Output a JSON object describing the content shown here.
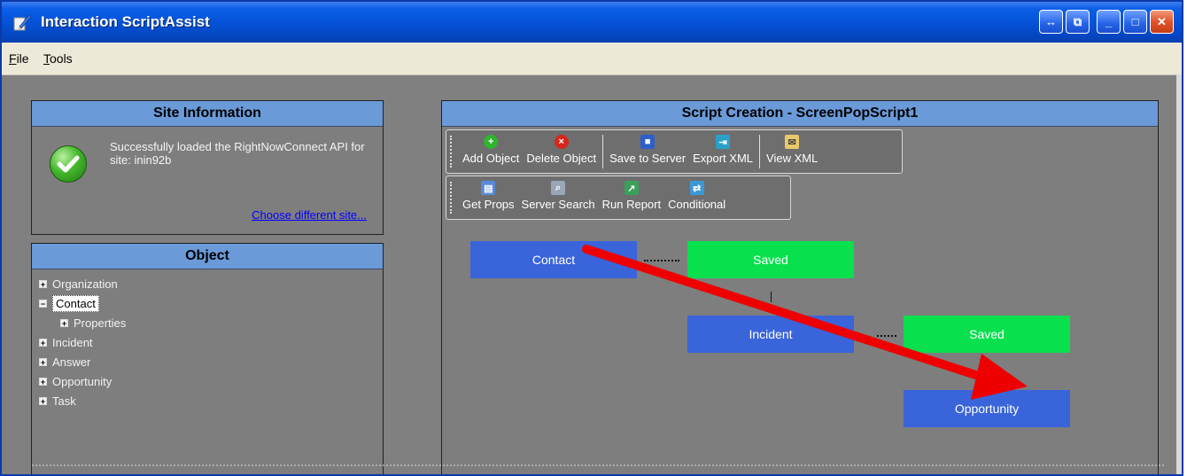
{
  "window": {
    "title": "Interaction ScriptAssist",
    "controls": [
      "↔",
      "⧉",
      "_",
      "□",
      "✕"
    ]
  },
  "menu": {
    "file": {
      "underline": "F",
      "rest": "ile"
    },
    "tools": {
      "underline": "T",
      "rest": "ools"
    }
  },
  "site_info": {
    "header": "Site Information",
    "message": "Successfully loaded the RightNowConnect API for site: inin92b",
    "link": "Choose different site..."
  },
  "object_panel": {
    "header": "Object",
    "tree": [
      {
        "label": "Organization",
        "sign": "+",
        "depth": 0,
        "selected": false
      },
      {
        "label": "Contact",
        "sign": "−",
        "depth": 0,
        "selected": true
      },
      {
        "label": "Properties",
        "sign": "+",
        "depth": 1,
        "selected": false
      },
      {
        "label": "Incident",
        "sign": "+",
        "depth": 0,
        "selected": false
      },
      {
        "label": "Answer",
        "sign": "+",
        "depth": 0,
        "selected": false
      },
      {
        "label": "Opportunity",
        "sign": "+",
        "depth": 0,
        "selected": false
      },
      {
        "label": "Task",
        "sign": "+",
        "depth": 0,
        "selected": false
      }
    ]
  },
  "script_creation": {
    "header": "Script Creation - ScreenPopScript1",
    "toolbar1": [
      {
        "label": "Add Object",
        "icon": "add-icon",
        "color": "#2fb52f",
        "glyph": "+"
      },
      {
        "label": "Delete Object",
        "icon": "delete-icon",
        "color": "#d8261b",
        "glyph": "×"
      },
      {
        "label": "Save to Server",
        "icon": "save-icon",
        "color": "#2f5fc8",
        "glyph": "■"
      },
      {
        "label": "Export XML",
        "icon": "export-icon",
        "color": "#2aa0c8",
        "glyph": "⇥"
      },
      {
        "label": "View XML",
        "icon": "view-icon",
        "color": "#e8c86a",
        "glyph": "✉"
      }
    ],
    "toolbar2": [
      {
        "label": "Get Props",
        "icon": "properties-icon",
        "color": "#5a8ad8",
        "glyph": "▤"
      },
      {
        "label": "Server Search",
        "icon": "search-icon",
        "color": "#9aa6b8",
        "glyph": "⌕"
      },
      {
        "label": "Run Report",
        "icon": "report-icon",
        "color": "#3aa05a",
        "glyph": "↗"
      },
      {
        "label": "Conditional",
        "icon": "conditional-icon",
        "color": "#3a9ad8",
        "glyph": "⇄"
      }
    ],
    "nodes": {
      "contact": "Contact",
      "contact_status": "Saved",
      "incident": "Incident",
      "incident_status": "Saved",
      "opportunity": "Opportunity"
    }
  },
  "colors": {
    "node_blue": "#3a64da",
    "node_green": "#08e04e",
    "arrow": "#ee0000",
    "panel_header": "#6a9ad8"
  }
}
